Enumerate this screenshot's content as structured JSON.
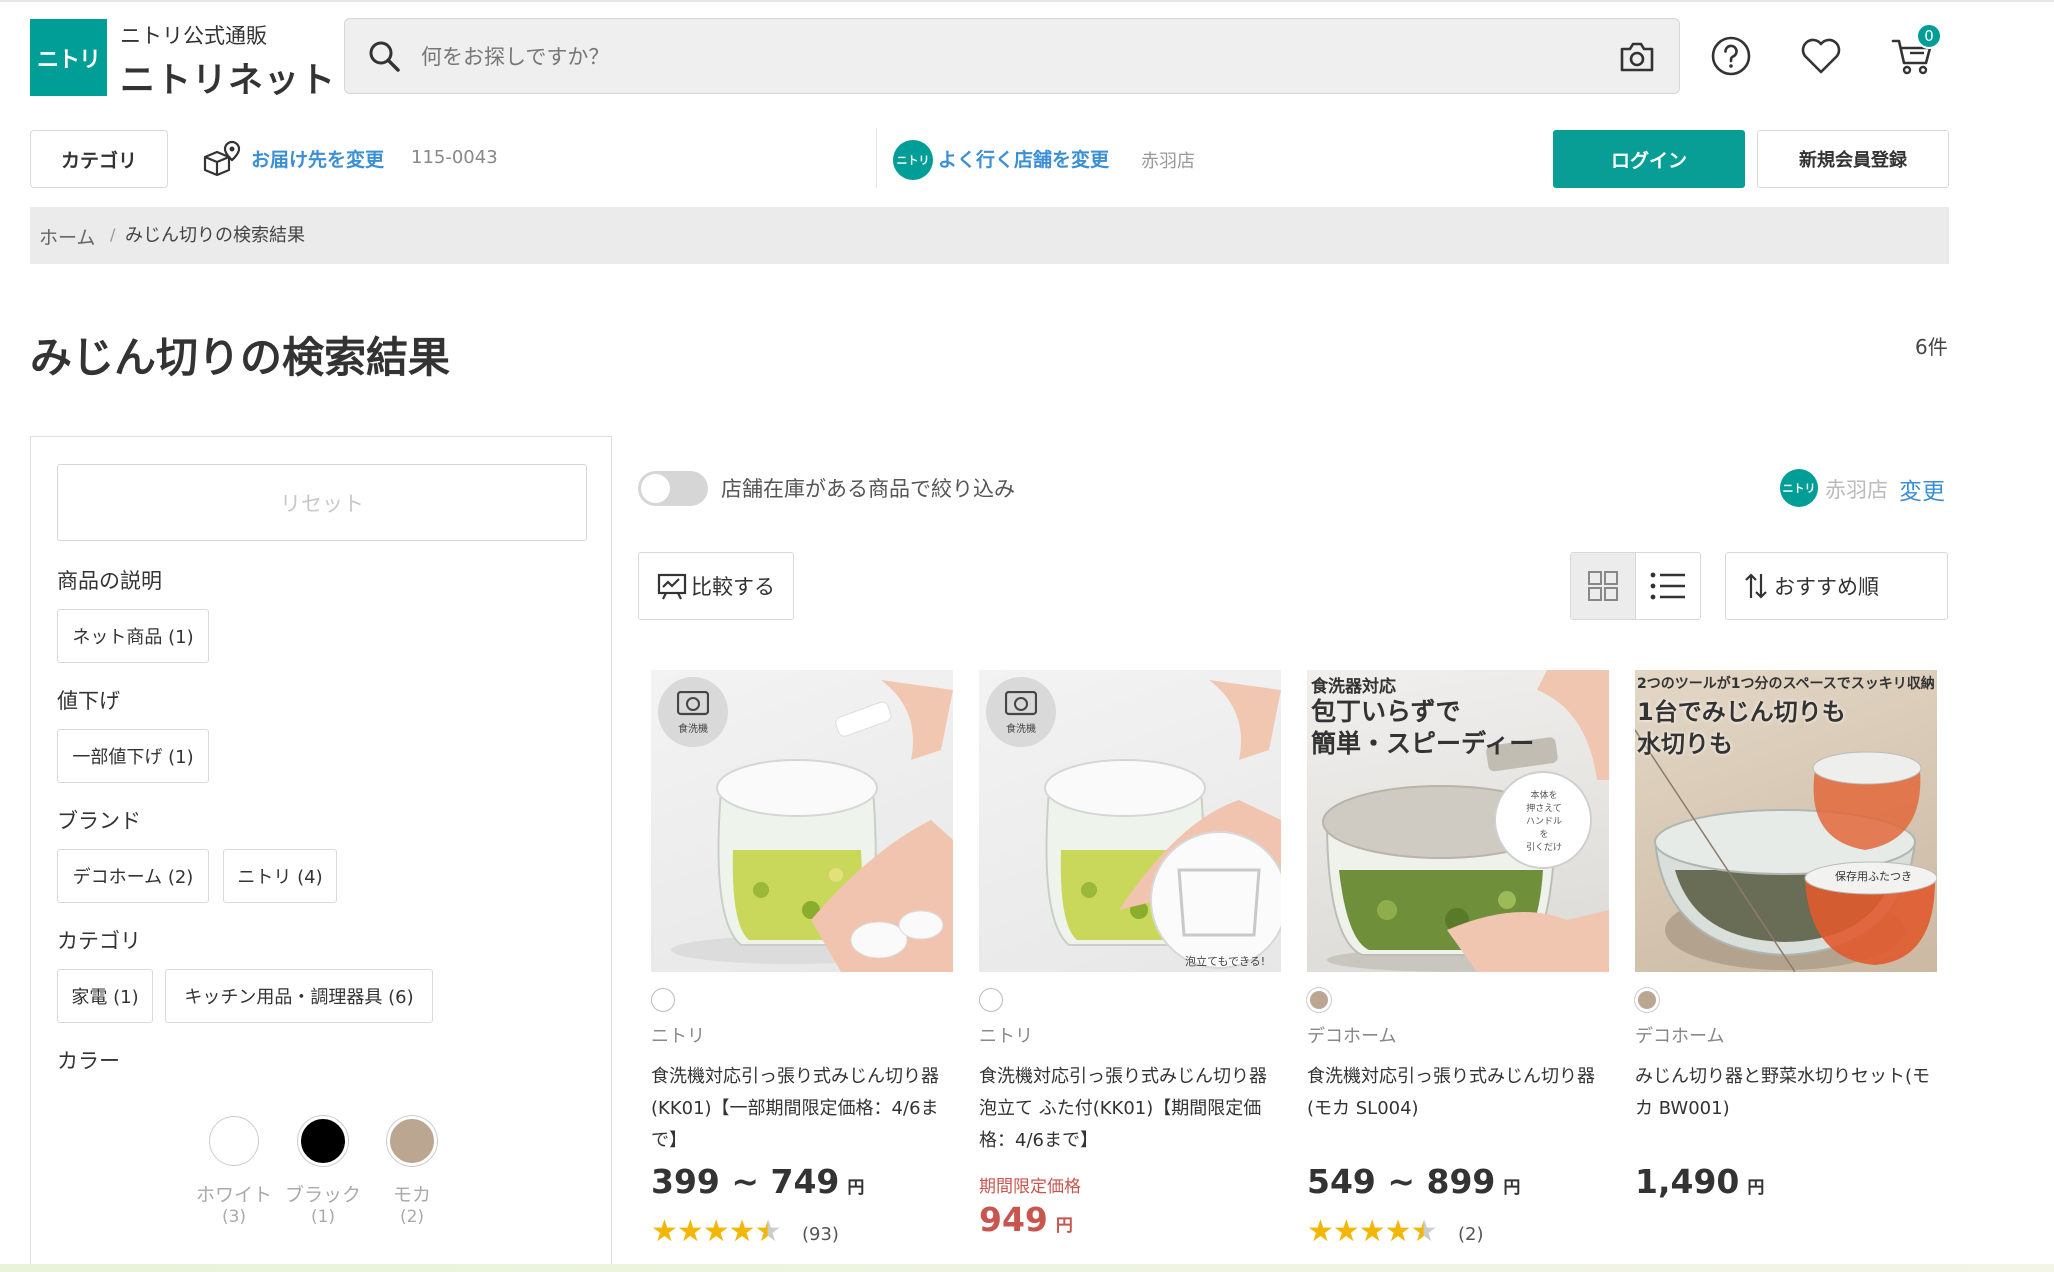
{
  "header": {
    "logo_mark": "ニトリ",
    "logo_sub": "ニトリ公式通販",
    "logo_main": "ニトリネット",
    "search_placeholder": "何をお探しですか？",
    "cart_count": "0"
  },
  "subheader": {
    "category_label": "カテゴリ",
    "delivery_link": "お届け先を変更",
    "delivery_zip": "115-0043",
    "store_link": "よく行く店舗を変更",
    "store_name": "赤羽店",
    "login_label": "ログイン",
    "register_label": "新規会員登録"
  },
  "breadcrumb": {
    "home": "ホーム",
    "separator": "/",
    "current": "みじん切りの検索結果"
  },
  "page": {
    "title": "みじん切りの検索結果",
    "count": "6件"
  },
  "filters": {
    "reset_label": "リセット",
    "groups": [
      {
        "title": "商品の説明",
        "chips": [
          "ネット商品 (1)"
        ]
      },
      {
        "title": "値下げ",
        "chips": [
          "一部値下げ (1)"
        ]
      },
      {
        "title": "ブランド",
        "chips": [
          "デコホーム (2)",
          "ニトリ (4)"
        ]
      },
      {
        "title": "カテゴリ",
        "chips": [
          "家電 (1)",
          "キッチン用品・調理器具 (6)"
        ]
      }
    ],
    "color_title": "カラー",
    "colors": [
      {
        "name": "ホワイト",
        "count": "(3)",
        "hex": "#ffffff"
      },
      {
        "name": "ブラック",
        "count": "(1)",
        "hex": "#000000"
      },
      {
        "name": "モカ",
        "count": "(2)",
        "hex": "#bba692"
      }
    ]
  },
  "toolbar": {
    "stock_filter_label": "店舗在庫がある商品で絞り込み",
    "store_name": "赤羽店",
    "change_label": "変更",
    "compare_label": "比較する",
    "sort_label": "おすすめ順"
  },
  "products": [
    {
      "brand": "ニトリ",
      "name": "食洗機対応引っ張り式みじん切り器(KK01)【一部期間限定価格：4/6まで】",
      "price": "399 ~ 749",
      "yen": "円",
      "limited_label": "",
      "rating": 4.5,
      "reviews": "(93)",
      "swatch": "#ffffff",
      "badge": "食洗機",
      "overlay": ""
    },
    {
      "brand": "ニトリ",
      "name": "食洗機対応引っ張り式みじん切り器 泡立て ふた付(KK01)【期間限定価格：4/6まで】",
      "price": "949",
      "yen": "円",
      "limited_label": "期間限定価格",
      "rating": 0,
      "reviews": "",
      "swatch": "#ffffff",
      "badge": "食洗機",
      "overlay": "泡立てもできる!"
    },
    {
      "brand": "デコホーム",
      "name": "食洗機対応引っ張り式みじん切り器(モカ SL004)",
      "price": "549 ~ 899",
      "yen": "円",
      "limited_label": "",
      "rating": 4.5,
      "reviews": "(2)",
      "swatch": "#bba692",
      "badge": "",
      "overlay": "食洗器対応\n包丁いらずで\n簡単・スピーディー"
    },
    {
      "brand": "デコホーム",
      "name": "みじん切り器と野菜水切りセット(モカ BW001)",
      "price": "1,490",
      "yen": "円",
      "limited_label": "",
      "rating": 0,
      "reviews": "",
      "swatch": "#bba692",
      "badge": "",
      "overlay": "2つのツールが1つ分のスペースでスッキリ収納\n1台でみじん切りも\n水切りも"
    }
  ],
  "icons": {
    "search": "search-icon",
    "camera": "camera-icon",
    "help": "help-icon",
    "favorite": "heart-icon",
    "cart": "cart-icon",
    "delivery": "delivery-box-icon",
    "compare": "compare-icon",
    "grid": "grid-view-icon",
    "list": "list-view-icon",
    "sort": "sort-icon"
  },
  "colors": {
    "brand": "#009e96",
    "link": "#3b8fd4",
    "limited": "#c9564e",
    "star": "#f2b705"
  }
}
